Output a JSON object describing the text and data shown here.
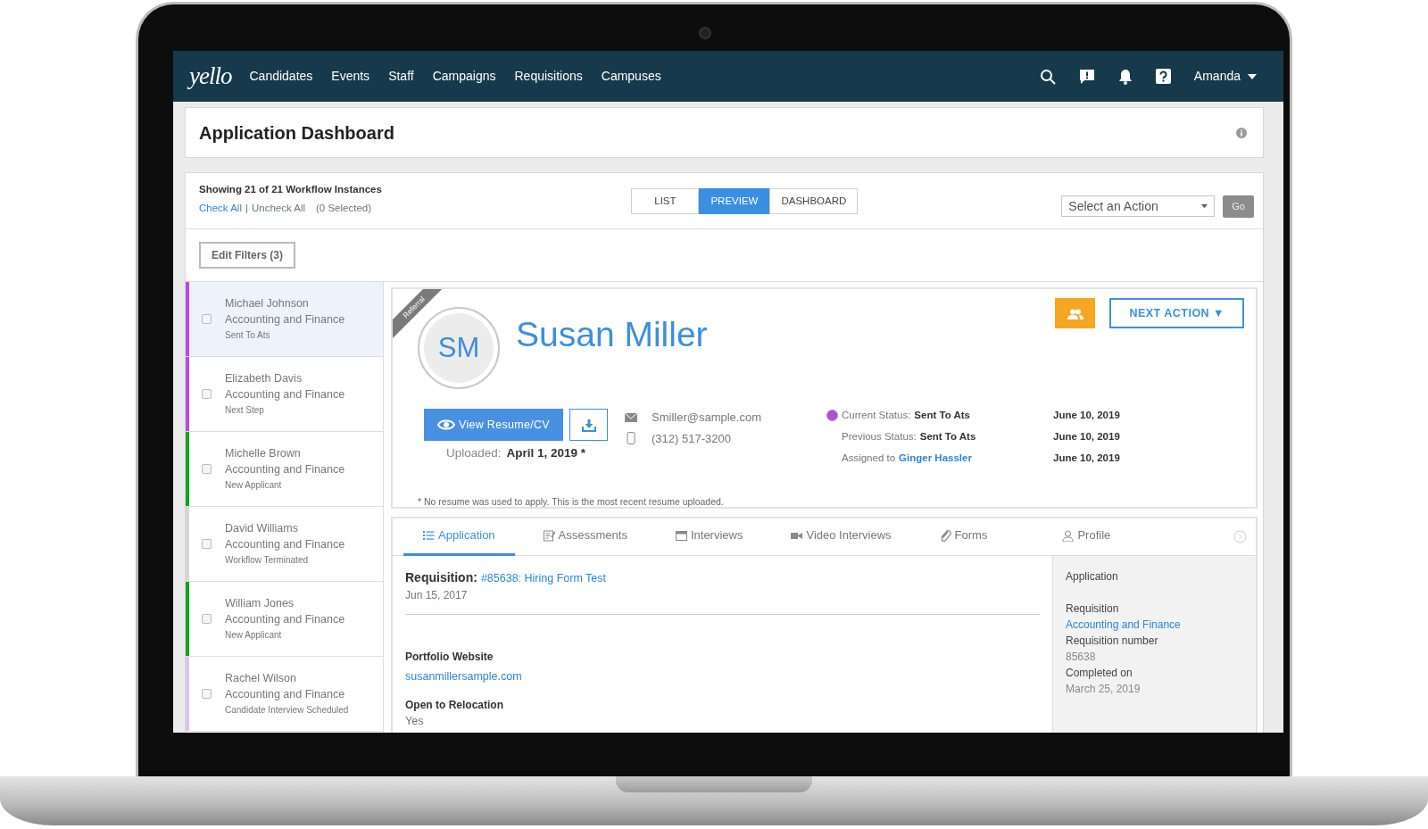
{
  "nav": {
    "logo": "yello",
    "links": [
      "Candidates",
      "Events",
      "Staff",
      "Campaigns",
      "Requisitions",
      "Campuses"
    ],
    "user": "Amanda"
  },
  "header": {
    "title": "Application Dashboard"
  },
  "toolbar": {
    "count": "Showing 21 of 21 Workflow Instances",
    "check_all": "Check All",
    "separator": "|",
    "uncheck_all": "Uncheck All",
    "selected_count": "(0 Selected)",
    "view_tabs": [
      {
        "label": "LIST",
        "selected": false
      },
      {
        "label": "PREVIEW",
        "selected": true
      },
      {
        "label": "DASHBOARD",
        "selected": false
      }
    ],
    "action_select": {
      "placeholder": "Select an Action"
    },
    "go_button": "Go",
    "edit_filters": "Edit Filters (3)"
  },
  "candidates": [
    {
      "name": "Michael Johnson",
      "department": "Accounting and Finance",
      "status": "Sent To Ats",
      "color": "#b54be6",
      "selected": true,
      "checked": false
    },
    {
      "name": "Elizabeth Davis",
      "department": "Accounting and Finance",
      "status": "Next Step",
      "color": "#b54be6",
      "selected": false,
      "checked": false
    },
    {
      "name": "Michelle Brown",
      "department": "Accounting and Finance",
      "status": "New Applicant",
      "color": "#14a31a",
      "selected": false,
      "checked": false
    },
    {
      "name": "David Williams",
      "department": "Accounting and Finance",
      "status": "Workflow Terminated",
      "color": "#d4d4d4",
      "selected": false,
      "checked": false
    },
    {
      "name": "William Jones",
      "department": "Accounting and Finance",
      "status": "New Applicant",
      "color": "#14a31a",
      "selected": false,
      "checked": false
    },
    {
      "name": "Rachel Wilson",
      "department": "Accounting and Finance",
      "status": "Candidate Interview Scheduled",
      "color": "#dcc2f2",
      "selected": false,
      "checked": false
    }
  ],
  "profile": {
    "ribbon": "Referral",
    "initials": "SM",
    "name": "Susan Miller",
    "next_action": "NEXT ACTION ▼",
    "view_resume": "View Resume/CV",
    "uploaded_label": "Uploaded:",
    "uploaded_date": "April 1, 2019 *",
    "email": "Smiller@sample.com",
    "phone": "(312) 517-3200",
    "statuses": [
      {
        "kind": "status",
        "label": "Current Status:",
        "value": "Sent To Ats",
        "date": "June 10, 2019",
        "color": "#b54be6"
      },
      {
        "kind": "status",
        "label": "Previous Status:",
        "value": "Sent To Ats",
        "date": "June 10, 2019"
      },
      {
        "kind": "link",
        "label": "Assigned to",
        "value": "Ginger Hassler",
        "date": "June 10, 2019"
      }
    ],
    "note": "* No resume was used to apply. This is the most recent resume uploaded."
  },
  "tabs": [
    {
      "label": "Application",
      "selected": true
    },
    {
      "label": "Assessments",
      "selected": false
    },
    {
      "label": "Interviews",
      "selected": false
    },
    {
      "label": "Video Interviews",
      "selected": false
    },
    {
      "label": "Forms",
      "selected": false
    },
    {
      "label": "Profile",
      "selected": false
    }
  ],
  "application": {
    "requisition_label": "Requisition:",
    "requisition_link": "#85638: Hiring Form Test",
    "requisition_date": "Jun 15, 2017",
    "fields": [
      {
        "label": "Portfolio Website",
        "value": "susanmillersample.com",
        "kind": "link"
      },
      {
        "label": "Open to Relocation",
        "value": "Yes",
        "kind": "text"
      }
    ]
  },
  "sidebar": {
    "heading": "Application",
    "items": [
      {
        "label": "Requisition",
        "value": "Accounting and Finance",
        "kind": "link"
      },
      {
        "label": "Requisition number",
        "value": "85638",
        "kind": "text"
      },
      {
        "label": "Completed on",
        "value": "March 25, 2019",
        "kind": "text"
      }
    ]
  }
}
